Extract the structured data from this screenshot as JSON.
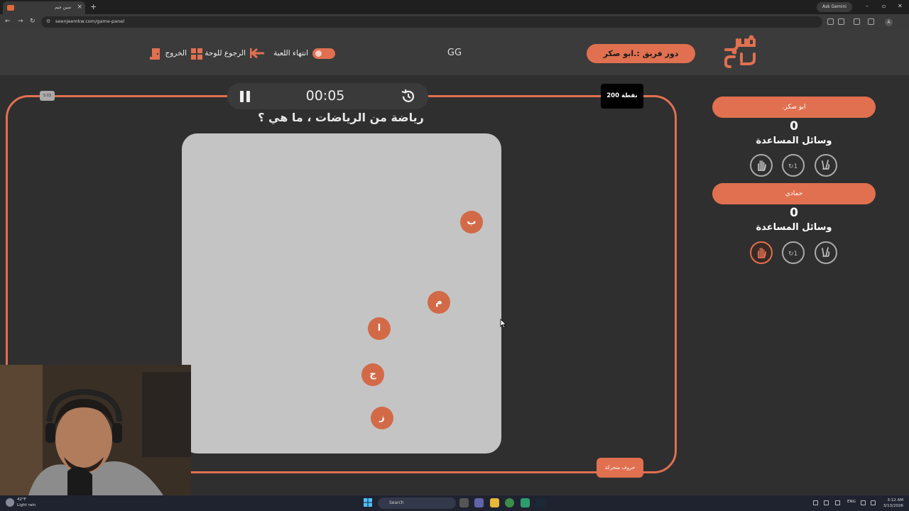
{
  "browser": {
    "tab_title": "سين جيم",
    "new_tab": "+",
    "url": "seenjeemkw.com/game-panel",
    "ask_gemini": "Ask Gemini",
    "profile_initial": "A",
    "minimize": "–",
    "maximize": "▫",
    "close": "✕"
  },
  "header": {
    "logo_text": "سين جيم",
    "turn_label": "دور فريق :.ابو صكر",
    "center_text": "GG",
    "end_game_label": "انتهاء اللعبة",
    "back_to_board_label": "الرجوع للوحة",
    "exit_label": "الخروج",
    "accent_color": "#e07050"
  },
  "question": {
    "timer": "00:05",
    "points": "200 نقطة",
    "tiny_tag": "5:03",
    "text": "رياضة من الرياضات ، ما هي ؟",
    "mode_badge": "حروف متحركة",
    "letters": [
      "ب",
      "م",
      "ا",
      "ج",
      "ز"
    ]
  },
  "teams": [
    {
      "name": ".ابو صكر",
      "score": "0",
      "aids_label": "وسائل المساعدة",
      "aids": [
        "hand-icon",
        "swap-icon",
        "peace-icon"
      ],
      "active_aid": null
    },
    {
      "name": "حمادي",
      "score": "0",
      "aids_label": "وسائل المساعدة",
      "aids": [
        "hand-icon",
        "swap-icon",
        "peace-icon"
      ],
      "active_aid": "hand-icon"
    }
  ],
  "taskbar": {
    "weather_temp": "42°F",
    "weather_desc": "Light rain",
    "search_placeholder": "Search",
    "lang": "ENG",
    "time": "3:12 AM",
    "date": "3/13/2026"
  }
}
